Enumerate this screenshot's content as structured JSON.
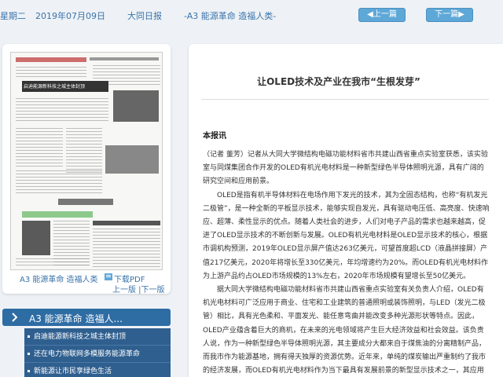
{
  "header": {
    "weekday": "星期二",
    "date": "2019年07月09日",
    "paper": "大同日报",
    "section": "-A3 能源革命 造福人类-",
    "prev_label": "上一篇",
    "next_label": "下一篇"
  },
  "thumbnail": {
    "page_label": "A3 能源革命 造福人类",
    "download_label": "下载PDF",
    "pager_label": "上一版 |下一版",
    "headline": "启迪能源新科技之城主体封顶"
  },
  "section_nav": {
    "title": "A3  能源革命 造福人...",
    "items": [
      "启迪能源新科技之城主体封顶",
      "还在电力物联网多模服务能源革命",
      "新能源让市民享绿色生活"
    ]
  },
  "article": {
    "title": "让OLED技术及产业在我市“生根发芽”",
    "byline": "本报讯",
    "paragraphs": [
      "（记者 董芳）记者从大同大学微结构电磁功能材料省市共建山西省重点实验室获悉，该实验室与同煤集团合作开发的OLED有机光电材料是一种新型绿色半导体照明光源，具有广阔的研究空间和应用前景。",
      "OLED是指有机半导体材料在电场作用下发光的技术，其为全固态结构，也称“有机发光二极管”，是一种全新的平板显示技术，能够实现自发光，具有驱动电压低、高亮度、快速响应、超薄、柔性显示的优点。随着人类社会的进步，人们对电子产品的需求也越来越高，促进了OLED显示技术的不断创新与发展。OLED有机光电材料是OLED显示技术的核心，根据市调机构预测，2019年OLED显示屏产值达263亿美元，可望首度超LCD（液晶拼接屏）产值217亿美元，2020年将增长至330亿美元，年均增速约为20%。而OLED有机光电材料作为上游产品约占OLED市场规模的13%左右，2020年市场规模有望增长至50亿美元。",
      "据大同大学微结构电磁功能材料省市共建山西省重点实验室有关负责人介绍，OLED有机光电材料可广泛应用于商业、住宅和工业建筑的普通照明或装饰照明，与LED（发光二极管）相比，具有光色柔和、平面发光、能任意弯曲并能改变多种光源形状等特点。因此，OLED产业蕴含着巨大的商机，在未来的光电领域将产生巨大经济效益和社会效益。该负责人说，作为一种新型绿色半导体照明光源，其主要成分大都来自于煤焦油的分离精制产品，而我市作为能源基地，拥有得天独厚的资源优势。近年来，单纯的煤炭输出严重制约了我市的经济发展，而OLED有机光电材料作为当下最具有发展前景的新型显示技术之一，其应用"
    ]
  },
  "colors": {
    "accent": "#2e6ca4",
    "link": "#3a73a9",
    "button": "#5ea8d8"
  }
}
